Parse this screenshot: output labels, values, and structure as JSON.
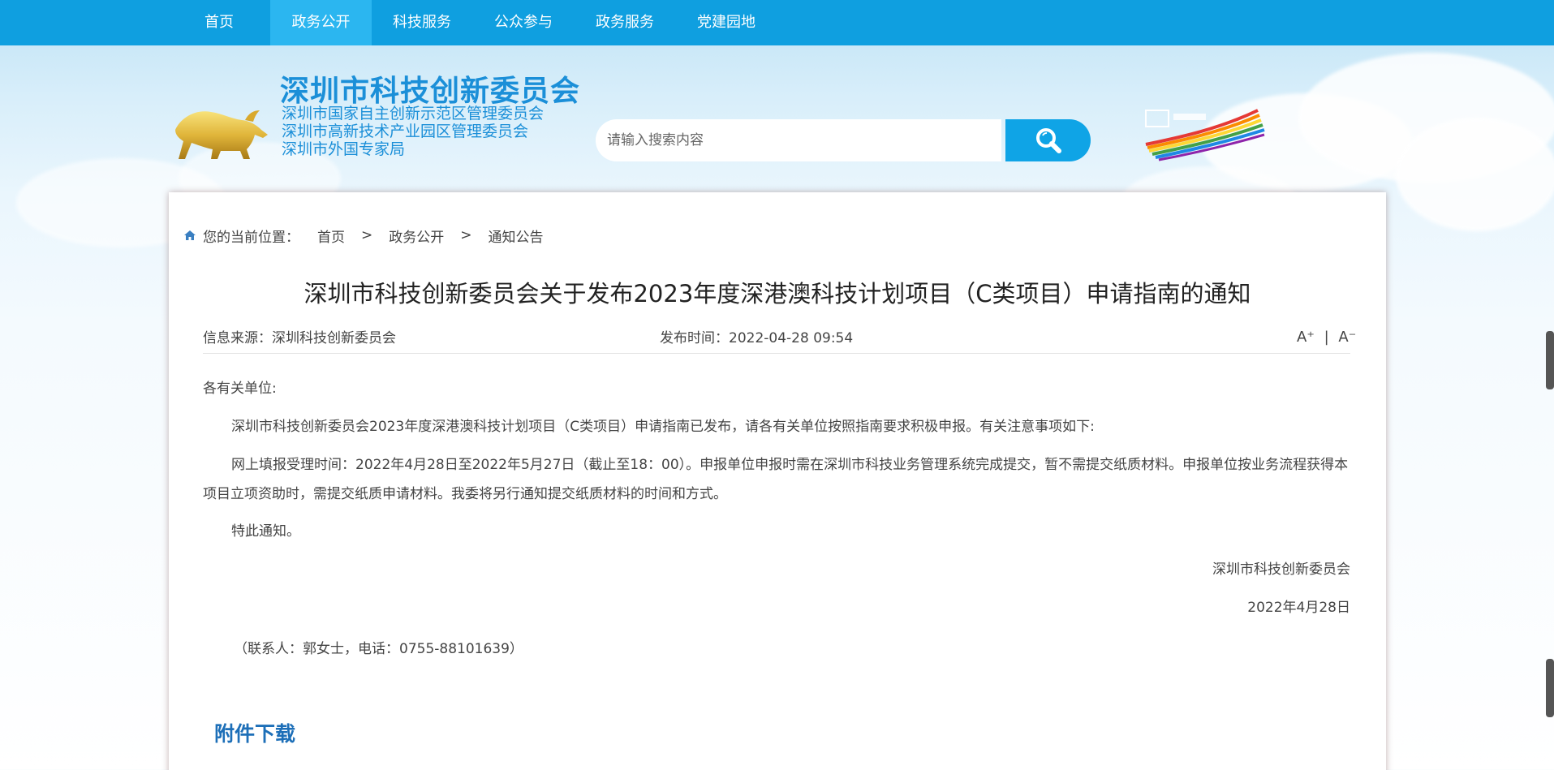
{
  "nav": {
    "items": [
      {
        "label": "首页",
        "active": false
      },
      {
        "label": "政务公开",
        "active": true
      },
      {
        "label": "科技服务",
        "active": false
      },
      {
        "label": "公众参与",
        "active": false
      },
      {
        "label": "政务服务",
        "active": false
      },
      {
        "label": "党建园地",
        "active": false
      }
    ]
  },
  "header": {
    "org_title": "深圳市科技创新委员会",
    "org_subtitles": [
      "深圳市国家自主创新示范区管理委员会",
      "深圳市高新技术产业园区管理委员会",
      "深圳市外国专家局"
    ],
    "search_placeholder": "请输入搜索内容",
    "search_icon": "search-icon",
    "shenzhen_logo_icon": "shenzhen-city-logo-icon"
  },
  "breadcrumb": {
    "label": "您的当前位置：",
    "items": [
      "首页",
      "政务公开",
      "通知公告"
    ],
    "separator": ">"
  },
  "article": {
    "title": "深圳市科技创新委员会关于发布2023年度深港澳科技计划项目（C类项目）申请指南的通知",
    "source": "信息来源：深圳科技创新委员会",
    "publish_time": "发布时间：2022-04-28 09:54",
    "font_increase": "A⁺",
    "font_sep": "|",
    "font_decrease": "A⁻",
    "salutation": "各有关单位:",
    "p1": "深圳市科技创新委员会2023年度深港澳科技计划项目（C类项目）申请指南已发布，请各有关单位按照指南要求积极申报。有关注意事项如下:",
    "p2": "网上填报受理时间：2022年4月28日至2022年5月27日（截止至18：00）。申报单位申报时需在深圳市科技业务管理系统完成提交，暂不需提交纸质材料。申报单位按业务流程获得本项目立项资助时，需提交纸质申请材料。我委将另行通知提交纸质材料的时间和方式。",
    "closing": "特此通知。",
    "signature": "深圳市科技创新委员会",
    "date": "2022年4月28日",
    "contact": "（联系人：郭女士，电话：0755-88101639）"
  },
  "attachments": {
    "heading": "附件下载"
  },
  "colors": {
    "nav_bg": "#0f9fe0",
    "nav_active": "#2bb6f0",
    "brand": "#1b8fd8",
    "attach_heading": "#1d6fb8"
  }
}
